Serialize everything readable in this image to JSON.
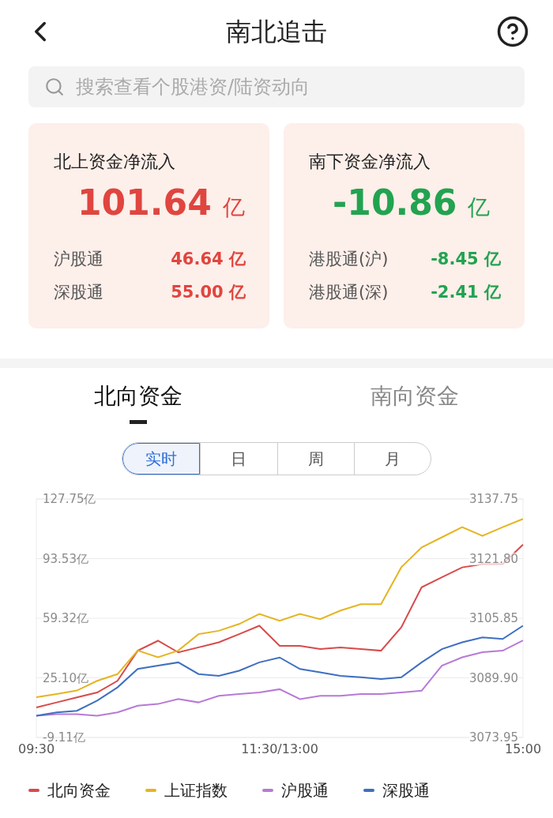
{
  "header": {
    "title": "南北追击"
  },
  "search": {
    "placeholder": "搜索查看个股港资/陆资动向"
  },
  "cards": [
    {
      "title": "北上资金净流入",
      "total": "101.64",
      "unit": "亿",
      "color": "#e0453f",
      "rows": [
        {
          "label": "沪股通",
          "value": "46.64",
          "unit": "亿"
        },
        {
          "label": "深股通",
          "value": "55.00",
          "unit": "亿"
        }
      ]
    },
    {
      "title": "南下资金净流入",
      "total": "-10.86",
      "unit": "亿",
      "color": "#22a350",
      "rows": [
        {
          "label": "港股通(沪)",
          "value": "-8.45",
          "unit": "亿"
        },
        {
          "label": "港股通(深)",
          "value": "-2.41",
          "unit": "亿"
        }
      ]
    }
  ],
  "tabs": [
    {
      "label": "北向资金",
      "selected": true
    },
    {
      "label": "南向资金",
      "selected": false
    }
  ],
  "periods": [
    {
      "label": "实时",
      "selected": true
    },
    {
      "label": "日",
      "selected": false
    },
    {
      "label": "周",
      "selected": false
    },
    {
      "label": "月",
      "selected": false
    }
  ],
  "chart": {
    "chart_data": {
      "type": "line",
      "grid": true,
      "categories": [
        "09:30",
        null,
        null,
        null,
        null,
        null,
        null,
        null,
        null,
        null,
        null,
        null,
        "11:30/13:00",
        null,
        null,
        null,
        null,
        null,
        null,
        null,
        null,
        null,
        null,
        null,
        "15:00"
      ],
      "ylim": [
        -9.11,
        127.75
      ],
      "yticks": [
        {
          "value": 127.75,
          "label": "127.75亿"
        },
        {
          "value": 93.53,
          "label": "93.53亿"
        },
        {
          "value": 59.32,
          "label": "59.32亿"
        },
        {
          "value": 25.1,
          "label": "25.10亿"
        },
        {
          "value": -9.11,
          "label": "-9.11亿"
        }
      ],
      "y2lim": [
        3073.95,
        3137.75
      ],
      "y2ticks": [
        {
          "value": 3137.75,
          "label": "3137.75"
        },
        {
          "value": 3121.8,
          "label": "3121.80"
        },
        {
          "value": 3105.85,
          "label": "3105.85"
        },
        {
          "value": 3089.9,
          "label": "3089.90"
        },
        {
          "value": 3073.95,
          "label": "3073.95"
        }
      ],
      "series": [
        {
          "name": "北向资金",
          "color": "#d94a4a",
          "values": [
            8.1,
            11.0,
            13.9,
            16.7,
            23.4,
            40.7,
            46.4,
            39.7,
            42.6,
            45.5,
            50.2,
            55.0,
            43.5,
            43.5,
            41.6,
            42.6,
            41.6,
            40.7,
            54.1,
            77.1,
            82.8,
            88.5,
            90.4,
            90.4,
            101.6
          ]
        },
        {
          "name": "上证指数",
          "color": "#e6b422",
          "axis": "y2",
          "values": [
            3084.7,
            3085.6,
            3086.5,
            3089.1,
            3090.9,
            3097.2,
            3095.4,
            3097.2,
            3101.6,
            3102.5,
            3104.3,
            3107.0,
            3105.2,
            3107.0,
            3105.6,
            3107.9,
            3109.6,
            3109.6,
            3119.5,
            3124.8,
            3127.5,
            3130.2,
            3127.9,
            3130.2,
            3132.4
          ]
        },
        {
          "name": "沪股通",
          "color": "#b77ad6",
          "values": [
            3.4,
            4.3,
            4.3,
            3.4,
            5.3,
            9.1,
            10.1,
            13.0,
            11.0,
            14.8,
            15.8,
            16.7,
            18.6,
            12.9,
            14.8,
            14.8,
            15.8,
            15.8,
            16.7,
            17.7,
            32.1,
            36.9,
            39.8,
            40.7,
            46.6
          ]
        },
        {
          "name": "深股通",
          "color": "#3e6fc0",
          "values": [
            3.4,
            5.3,
            6.2,
            12.0,
            19.6,
            30.2,
            32.1,
            34.0,
            27.3,
            26.3,
            29.2,
            34.0,
            36.8,
            30.2,
            28.3,
            26.3,
            25.4,
            24.4,
            25.4,
            34.0,
            41.6,
            45.5,
            48.3,
            47.4,
            55.0
          ]
        }
      ]
    }
  }
}
